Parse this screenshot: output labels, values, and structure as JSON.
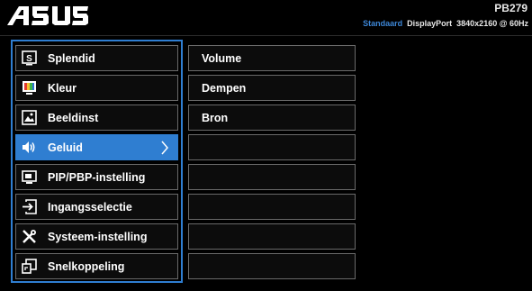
{
  "header": {
    "brand": "ASUS",
    "model": "PB279",
    "status": {
      "mode": "Standaard",
      "input": "DisplayPort",
      "resolution": "3840x2160 @ 60Hz"
    }
  },
  "menu": [
    {
      "label": "Splendid",
      "icon": "splendid-icon"
    },
    {
      "label": "Kleur",
      "icon": "color-icon"
    },
    {
      "label": "Beeldinst",
      "icon": "image-icon"
    },
    {
      "label": "Geluid",
      "icon": "speaker-icon",
      "selected": true
    },
    {
      "label": "PIP/PBP-instelling",
      "icon": "pip-icon"
    },
    {
      "label": "Ingangsselectie",
      "icon": "input-select-icon"
    },
    {
      "label": "Systeem-instelling",
      "icon": "tools-icon"
    },
    {
      "label": "Snelkoppeling",
      "icon": "shortcut-icon"
    }
  ],
  "submenu": [
    {
      "label": "Volume"
    },
    {
      "label": "Dempen"
    },
    {
      "label": "Bron"
    },
    {
      "label": ""
    },
    {
      "label": ""
    },
    {
      "label": ""
    },
    {
      "label": ""
    },
    {
      "label": ""
    }
  ],
  "colors": {
    "accent": "#2f7ed1",
    "mode_text": "#3d86d6",
    "border": "#6a6a6a",
    "background": "#000000"
  }
}
